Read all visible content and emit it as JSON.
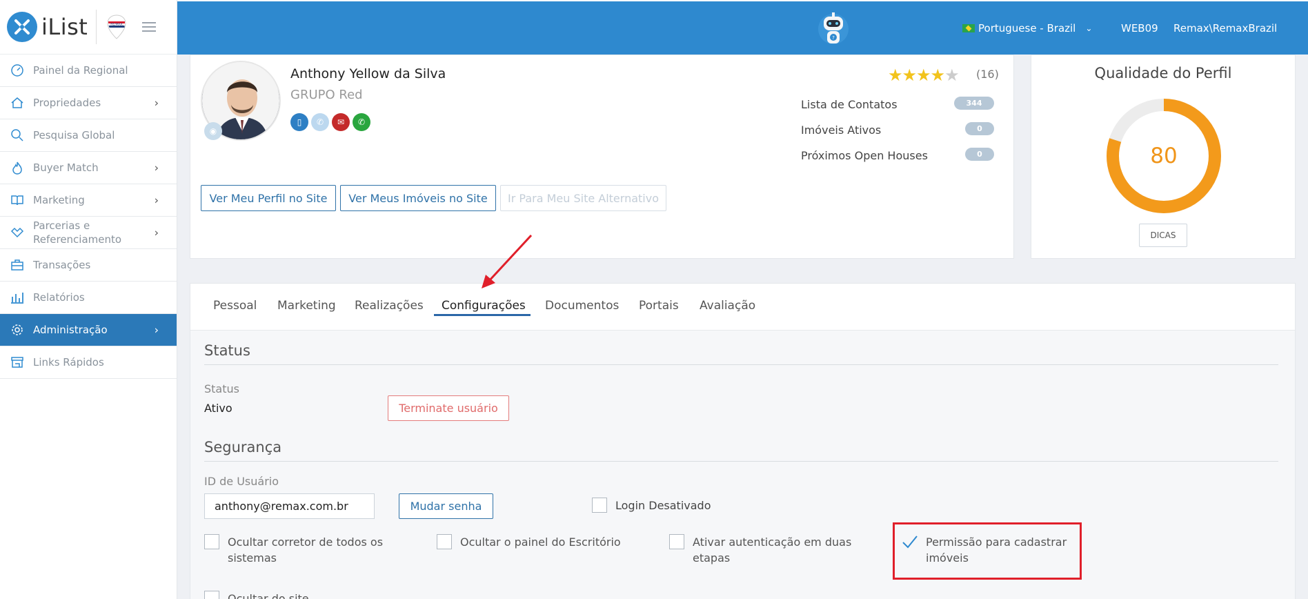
{
  "app": {
    "logo_text": "iList",
    "brand_badge": "RE/MAX"
  },
  "sidebar": {
    "items": [
      {
        "label": "Painel da Regional",
        "icon": "dashboard-gauge-icon",
        "has_chevron": false
      },
      {
        "label": "Propriedades",
        "icon": "home-icon",
        "has_chevron": true
      },
      {
        "label": "Pesquisa Global",
        "icon": "search-icon",
        "has_chevron": false
      },
      {
        "label": "Buyer Match",
        "icon": "flame-icon",
        "has_chevron": true
      },
      {
        "label": "Marketing",
        "icon": "book-open-icon",
        "has_chevron": true
      },
      {
        "label": "Parcerias e",
        "label2": "Referenciamento",
        "icon": "handshake-icon",
        "has_chevron": true
      },
      {
        "label": "Transações",
        "icon": "briefcase-icon",
        "has_chevron": false
      },
      {
        "label": "Relatórios",
        "icon": "bar-chart-icon",
        "has_chevron": false
      },
      {
        "label": "Administração",
        "icon": "gear-icon",
        "has_chevron": true,
        "active": true
      },
      {
        "label": "Links Rápidos",
        "icon": "storefront-icon",
        "has_chevron": false
      }
    ]
  },
  "topbar": {
    "language": "Portuguese - Brazil",
    "code": "WEB09",
    "user": "Remax\\RemaxBrazil"
  },
  "profile": {
    "name": "Anthony Yellow da Silva",
    "group": "GRUPO Red",
    "rating": 4,
    "rating_max": 5,
    "rating_count": "(16)",
    "stats": [
      {
        "label": "Lista de Contatos",
        "value": "344"
      },
      {
        "label": "Imóveis Ativos",
        "value": "0"
      },
      {
        "label": "Próximos Open Houses",
        "value": "0"
      }
    ],
    "buttons": {
      "profile_site": "Ver Meu Perfil no Site",
      "listings_site": "Ver Meus Imóveis no Site",
      "alt_site": "Ir Para Meu Site Alternativo"
    }
  },
  "quality": {
    "title": "Qualidade do Perfil",
    "value": "80",
    "percent": 80,
    "tips_button": "DICAS",
    "color": "#f39a1b"
  },
  "tabs": {
    "items": [
      "Pessoal",
      "Marketing",
      "Realizações",
      "Configurações",
      "Documentos",
      "Portais",
      "Avaliação"
    ],
    "active": "Configurações"
  },
  "status_section": {
    "title": "Status",
    "label": "Status",
    "value": "Ativo",
    "terminate_button": "Terminate usuário"
  },
  "security_section": {
    "title": "Segurança",
    "user_id_label": "ID de Usuário",
    "user_id_value": "anthony@remax.com.br",
    "change_password_button": "Mudar senha",
    "login_disabled_label": "Login Desativado",
    "checkboxes": [
      {
        "label_line1": "Ocultar corretor de todos os",
        "label_line2": "sistemas",
        "checked": false
      },
      {
        "label_line1": "Ocultar o painel do Escritório",
        "label_line2": "",
        "checked": false
      },
      {
        "label_line1": "Ativar autenticação em duas",
        "label_line2": "etapas",
        "checked": false
      },
      {
        "label_line1": "Permissão para cadastrar",
        "label_line2": "imóveis",
        "checked": true
      }
    ],
    "hide_site_label": "Ocultar do site"
  },
  "colors": {
    "primary": "#2e89cf",
    "sidebar_active": "#2b79b8",
    "highlight": "#e01f2a",
    "star": "#f2c31c"
  }
}
